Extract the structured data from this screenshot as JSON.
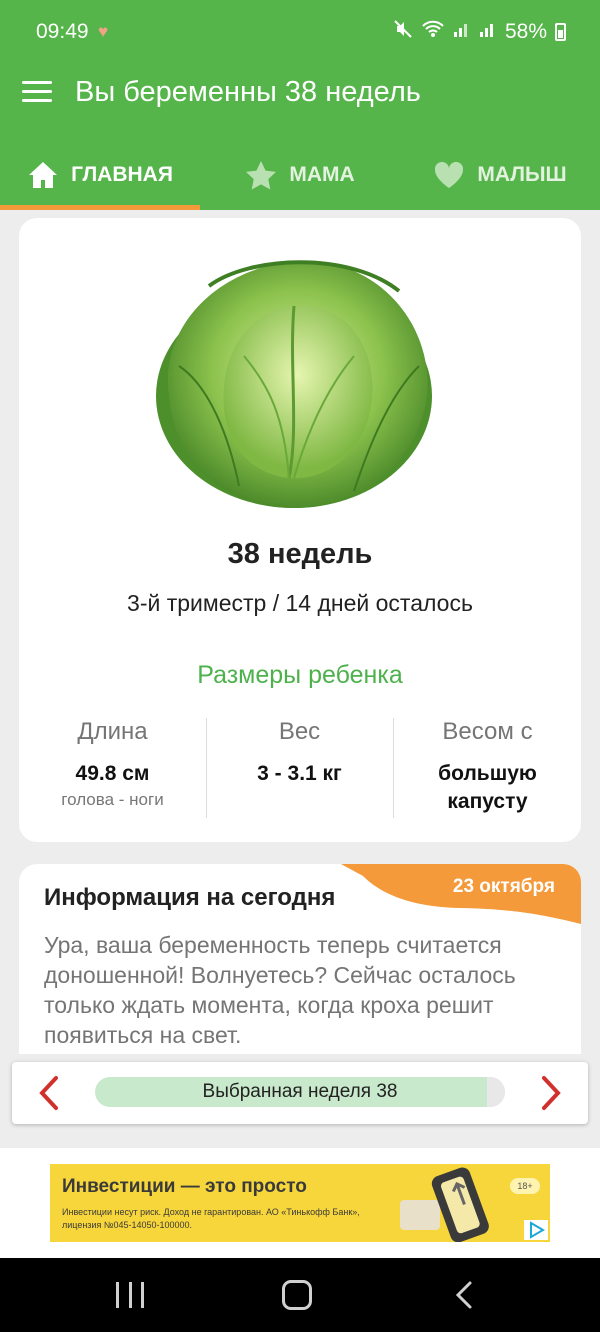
{
  "status_bar": {
    "time": "09:49",
    "battery": "58%",
    "icons": [
      "heart-monitor-icon",
      "mute-icon",
      "wifi-icon",
      "signal-icon",
      "signal-icon",
      "battery-icon"
    ]
  },
  "app_bar": {
    "title": "Вы беременны 38 недель",
    "menu_icon": "hamburger-menu-icon"
  },
  "tabs": [
    {
      "label": "ГЛАВНАЯ",
      "icon": "home-icon",
      "active": true
    },
    {
      "label": "МАМА",
      "icon": "star-icon",
      "active": false
    },
    {
      "label": "МАЛЫШ",
      "icon": "heart-icon",
      "active": false
    }
  ],
  "main_card": {
    "image": "cabbage",
    "weeks": "38 недель",
    "trimester": "3-й триместр / 14 дней осталось",
    "sizes_title": "Размеры ребенка",
    "length": {
      "label": "Длина",
      "value": "49.8 см",
      "note": "голова - ноги"
    },
    "weight": {
      "label": "Вес",
      "value": "3 - 3.1 кг"
    },
    "like": {
      "label": "Весом с",
      "value": "большую капусту"
    }
  },
  "info_card": {
    "title": "Информация на сегодня",
    "date": "23 октября",
    "text": "Ура, ваша беременность теперь считается доношенной! Волнуетесь? Сейчас осталось только ждать момента, когда кроха решит появиться на свет."
  },
  "week_selector": {
    "label": "Выбранная неделя 38",
    "progress": 0.956
  },
  "ad": {
    "headline": "Инвестиции — это просто",
    "disclaimer": "Инвестиции несут риск. Доход не гарантирован. АО «Тинькофф Банк», лицензия №045-14050-100000.",
    "age": "18+"
  },
  "colors": {
    "primary": "#55b44a",
    "accent": "#f59a3a",
    "sizes_title": "#4db24b",
    "arrow": "#d0312d"
  }
}
